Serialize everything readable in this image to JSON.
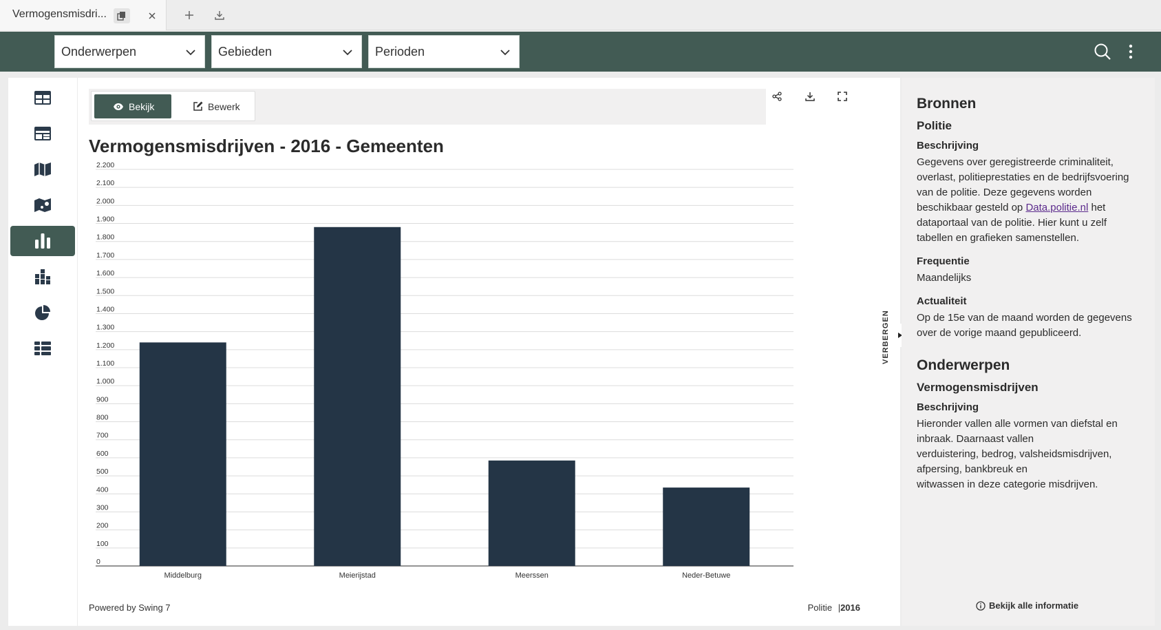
{
  "tab": {
    "title": "Vermogensmisdri..."
  },
  "toolbar": {
    "dropdowns": [
      {
        "label": "Onderwerpen"
      },
      {
        "label": "Gebieden"
      },
      {
        "label": "Perioden"
      }
    ]
  },
  "sidebar": {
    "items": [
      {
        "icon": "table-icon",
        "active": false
      },
      {
        "icon": "dashboard-icon",
        "active": false
      },
      {
        "icon": "map-icon",
        "active": false
      },
      {
        "icon": "map-points-icon",
        "active": false
      },
      {
        "icon": "bar-chart-icon",
        "active": true
      },
      {
        "icon": "stacked-chart-icon",
        "active": false
      },
      {
        "icon": "pie-chart-icon",
        "active": false
      },
      {
        "icon": "tiles-icon",
        "active": false
      }
    ]
  },
  "view": {
    "view_label": "Bekijk",
    "edit_label": "Bewerk"
  },
  "chart_data": {
    "type": "bar",
    "title": "Vermogensmisdrijven - 2016 - Gemeenten",
    "categories": [
      "Middelburg",
      "Meierijstad",
      "Meerssen",
      "Neder-Betuwe"
    ],
    "values": [
      1240,
      1880,
      585,
      435
    ],
    "ylim": [
      0,
      2200
    ],
    "ytick_step": 100,
    "ytick_labels": [
      "0",
      "100",
      "200",
      "300",
      "400",
      "500",
      "600",
      "700",
      "800",
      "900",
      "1.000",
      "1.100",
      "1.200",
      "1.300",
      "1.400",
      "1.500",
      "1.600",
      "1.700",
      "1.800",
      "1.900",
      "2.000",
      "2.100",
      "2.200"
    ],
    "bar_color": "#243546",
    "grid": true
  },
  "footer": {
    "powered": "Powered by Swing 7",
    "source": "Politie",
    "year": "2016"
  },
  "hide_label": "VERBERGEN",
  "info": {
    "bronnen_title": "Bronnen",
    "source_name": "Politie",
    "desc_label": "Beschrijving",
    "desc_part1": "Gegevens over geregistreerde criminaliteit, overlast, politieprestaties en de bedrijfsvoering van de politie. Deze gegevens worden beschikbaar gesteld op ",
    "desc_link": "Data.politie.nl",
    "desc_part2": " het dataportaal van de politie. Hier kunt u zelf tabellen en grafieken samenstellen.",
    "freq_label": "Frequentie",
    "freq_value": "Maandelijks",
    "actual_label": "Actualiteit",
    "actual_value": "Op de 15e van de maand worden de gegevens over de vorige maand gepubliceerd.",
    "onderwerpen_title": "Onderwerpen",
    "subject_name": "Vermogensmisdrijven",
    "subject_desc_label": "Beschrijving",
    "subject_desc_line1": "Hieronder vallen alle vormen van diefstal en inbraak. Daarnaast vallen",
    "subject_desc_line2": "verduistering, bedrog, valsheidsmisdrijven, afpersing, bankbreuk en",
    "subject_desc_line3": "witwassen in deze categorie misdrijven.",
    "more_label": "Bekijk alle informatie"
  }
}
